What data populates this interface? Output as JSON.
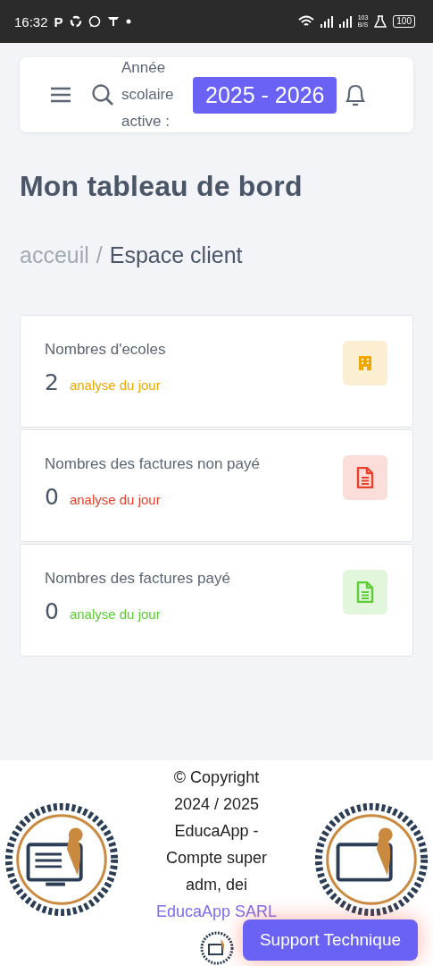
{
  "status_bar": {
    "time": "16:32",
    "app_letter": "P",
    "speed_value": "103",
    "speed_unit": "B/S",
    "battery": "100"
  },
  "header": {
    "year_label": "Année scolaire active :",
    "year": "2025 - 2026"
  },
  "page_title": "Mon tableau de bord",
  "breadcrumb": {
    "parent": "acceuil",
    "separator": "/",
    "current": "Espace client"
  },
  "cards": [
    {
      "label": "Nombres d'ecoles",
      "value": "2",
      "note": "analyse du jour",
      "color": "#f0a800",
      "kind": "building"
    },
    {
      "label": "Nombres des factures non payé",
      "value": "0",
      "note": "analyse du jour",
      "color": "#e8402a",
      "kind": "document"
    },
    {
      "label": "Nombres des factures payé",
      "value": "0",
      "note": "analyse du jour",
      "color": "#5ccd36",
      "kind": "document"
    }
  ],
  "footer": {
    "copyright": "© Copyright 2024 / 2025 EducaApp - Compte super adm, dei",
    "link": "EducaApp SARL"
  },
  "support_button": "Support Technique"
}
